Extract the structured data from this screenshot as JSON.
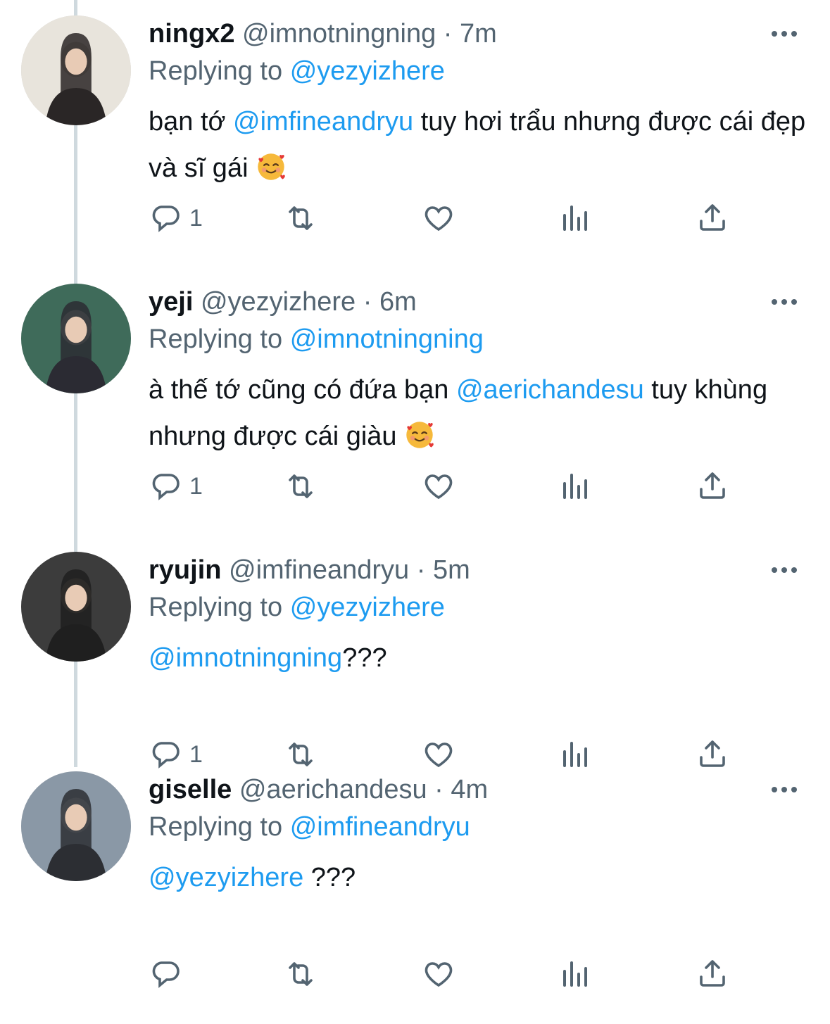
{
  "tweets": [
    {
      "name": "ningx2",
      "handle": "@imnotningning",
      "time": "· 7m",
      "replying_prefix": "Replying to",
      "replying_to": "@yezyizhere",
      "body_parts": [
        {
          "text": "bạn tớ ",
          "type": "text"
        },
        {
          "text": "@imfineandryu",
          "type": "link"
        },
        {
          "text": " tuy hơi trẩu nhưng được cái đẹp và sĩ gái ",
          "type": "text"
        }
      ],
      "emoji": "smiling-face-with-hearts",
      "reply_count": "1"
    },
    {
      "name": "yeji",
      "handle": "@yezyizhere",
      "time": "· 6m",
      "replying_prefix": "Replying to",
      "replying_to": "@imnotningning",
      "body_parts": [
        {
          "text": "à thế tớ cũng có đứa bạn ",
          "type": "text"
        },
        {
          "text": "@aerichandesu",
          "type": "link"
        },
        {
          "text": " tuy khùng nhưng được cái giàu ",
          "type": "text"
        }
      ],
      "emoji": "smiling-face-with-hearts",
      "reply_count": "1"
    },
    {
      "name": "ryujin",
      "handle": "@imfineandryu",
      "time": "· 5m",
      "replying_prefix": "Replying to",
      "replying_to": "@yezyizhere",
      "body_parts": [
        {
          "text": "@imnotningning",
          "type": "link"
        },
        {
          "text": "???",
          "type": "text"
        }
      ],
      "emoji": "",
      "reply_count": "1"
    },
    {
      "name": "giselle",
      "handle": "@aerichandesu",
      "time": "· 4m",
      "replying_prefix": "Replying to",
      "replying_to": "@imfineandryu",
      "body_parts": [
        {
          "text": "@yezyizhere",
          "type": "link"
        },
        {
          "text": " ???",
          "type": "text"
        }
      ],
      "emoji": "",
      "reply_count": ""
    }
  ],
  "icons": {
    "reply": "reply-icon",
    "retweet": "retweet-icon",
    "like": "heart-icon",
    "views": "views-icon",
    "share": "share-icon",
    "more": "more-icon"
  },
  "colors": {
    "link": "#1d9bf0",
    "muted": "#536471",
    "text": "#0f1419",
    "thread": "#cfd9de"
  }
}
